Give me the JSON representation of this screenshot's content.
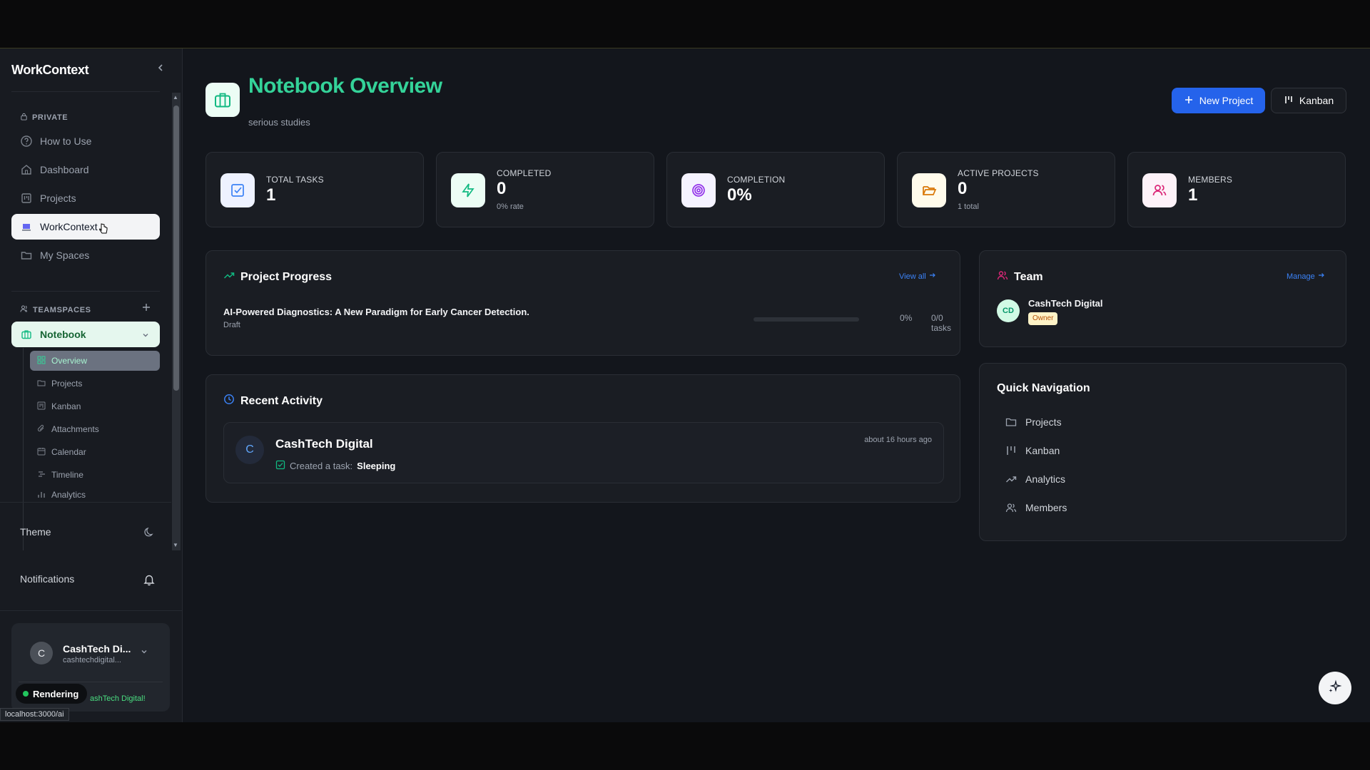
{
  "app": {
    "brand": "WorkContext"
  },
  "sidebar": {
    "private_label": "PRIVATE",
    "private_items": [
      {
        "label": "How to Use",
        "icon": "help-circle-icon"
      },
      {
        "label": "Dashboard",
        "icon": "home-icon"
      },
      {
        "label": "Projects",
        "icon": "kanban-icon"
      },
      {
        "label": "WorkContext",
        "icon": "workcontext-icon"
      },
      {
        "label": "My Spaces",
        "icon": "folder-icon"
      }
    ],
    "teamspaces_label": "TEAMSPACES",
    "team": {
      "label": "Notebook"
    },
    "team_sub": [
      {
        "label": "Overview"
      },
      {
        "label": "Projects"
      },
      {
        "label": "Kanban"
      },
      {
        "label": "Attachments"
      },
      {
        "label": "Calendar"
      },
      {
        "label": "Timeline"
      },
      {
        "label": "Analytics"
      }
    ],
    "theme_label": "Theme",
    "notifications_label": "Notifications",
    "user": {
      "initial": "C",
      "name": "CashTech Di...",
      "email": "cashtechdigital...",
      "welcome": "ashTech Digital!"
    },
    "render_badge": "Rendering",
    "status_url": "localhost:3000/ai"
  },
  "header": {
    "title": "Notebook Overview",
    "subtitle": "serious studies",
    "new_project": "New Project",
    "kanban": "Kanban"
  },
  "stats": [
    {
      "label": "TOTAL TASKS",
      "value": "1",
      "sub": "",
      "icon": "check-square-icon"
    },
    {
      "label": "COMPLETED",
      "value": "0",
      "sub": "0% rate",
      "icon": "zap-icon"
    },
    {
      "label": "COMPLETION",
      "value": "0%",
      "sub": "",
      "icon": "target-icon"
    },
    {
      "label": "ACTIVE PROJECTS",
      "value": "0",
      "sub": "1 total",
      "icon": "folder-open-icon"
    },
    {
      "label": "MEMBERS",
      "value": "1",
      "sub": "",
      "icon": "users-icon"
    }
  ],
  "project_progress": {
    "title": "Project Progress",
    "view_all": "View all",
    "project": {
      "name": "AI-Powered Diagnostics: A New Paradigm for Early Cancer Detection.",
      "status": "Draft",
      "percent_label": "0%",
      "progress": 0,
      "tasks": "0/0 tasks"
    }
  },
  "recent_activity": {
    "title": "Recent Activity",
    "item": {
      "avatar": "C",
      "name": "CashTech Digital",
      "action": "Created a task:",
      "target": "Sleeping",
      "time": "about 16 hours ago"
    }
  },
  "team": {
    "title": "Team",
    "manage": "Manage",
    "member": {
      "initials": "CD",
      "name": "CashTech Digital",
      "role": "Owner"
    }
  },
  "quick_nav": {
    "title": "Quick Navigation",
    "items": [
      {
        "label": "Projects",
        "icon": "folder-icon"
      },
      {
        "label": "Kanban",
        "icon": "kanban-icon"
      },
      {
        "label": "Analytics",
        "icon": "trending-up-icon"
      },
      {
        "label": "Members",
        "icon": "users-icon"
      }
    ]
  },
  "colors": {
    "accent": "#34d399",
    "primary_button": "#2563eb",
    "background": "#13161c",
    "card": "#1a1d23"
  }
}
